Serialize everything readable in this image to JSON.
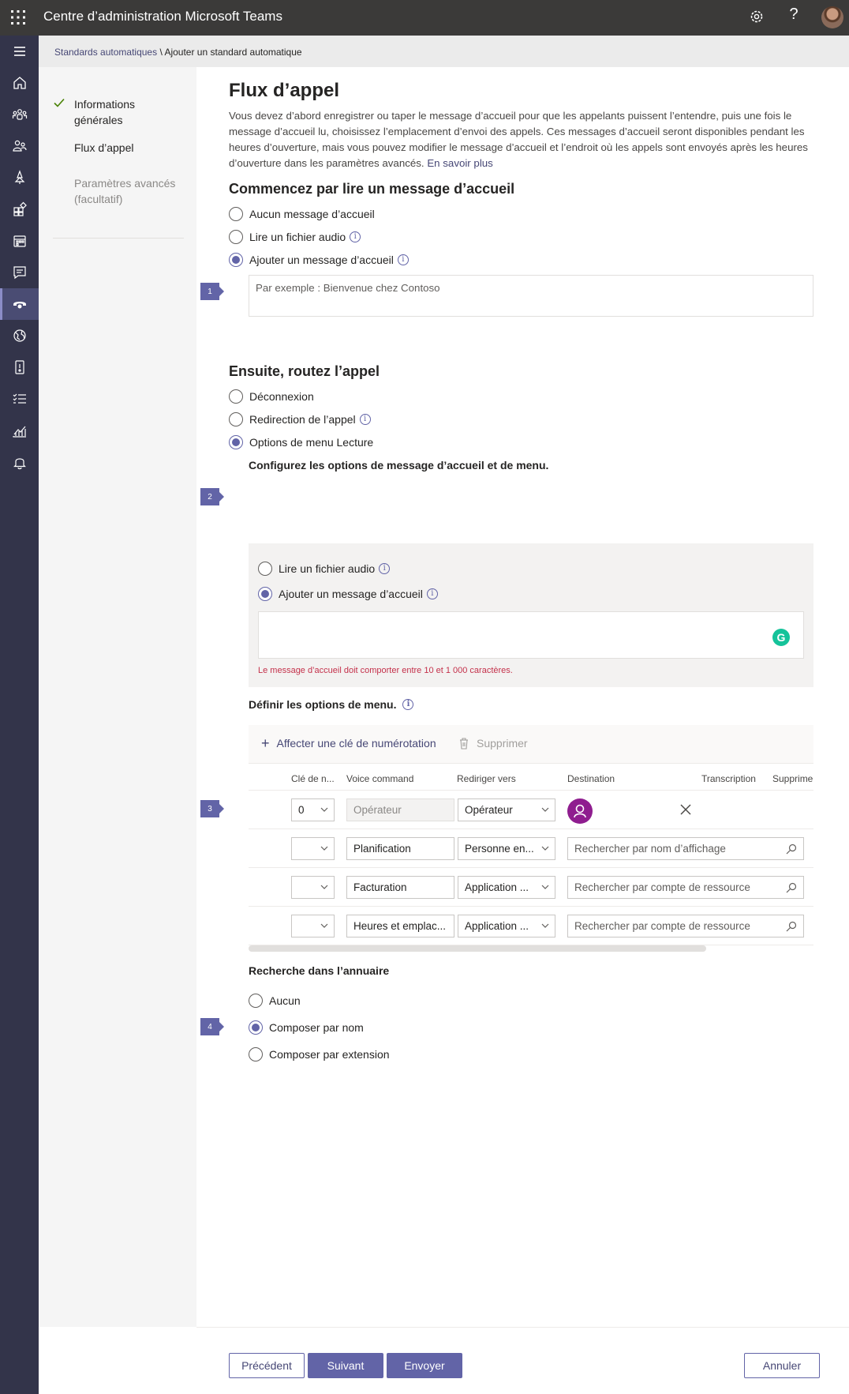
{
  "app": {
    "title": "Centre d’administration Microsoft Teams"
  },
  "breadcrumb": {
    "parent": "Standards automatiques",
    "separator": "\\",
    "current": "Ajouter un standard automatique"
  },
  "steps": [
    {
      "label": "Informations générales",
      "state": "done"
    },
    {
      "label": "Flux d’appel",
      "state": "current"
    },
    {
      "label": "Paramètres avancés (facultatif)",
      "state": "pending"
    }
  ],
  "page": {
    "title": "Flux d’appel",
    "intro": "Vous devez d’abord enregistrer ou taper le message d’accueil pour que les appelants puissent l’entendre, puis une fois le message d’accueil lu, choisissez l’emplacement d’envoi des appels. Ces messages d’accueil seront disponibles pendant les heures d’ouverture, mais vous pouvez modifier le message d’accueil et l’endroit où les appels sont envoyés après les heures d’ouverture dans les paramètres avancés.",
    "learn_more": "En savoir plus"
  },
  "greeting": {
    "title": "Commencez par lire un message d’accueil",
    "options": [
      "Aucun message d’accueil",
      "Lire un fichier audio",
      "Ajouter un message d’accueil"
    ],
    "selected": 2,
    "placeholder": "Par exemple : Bienvenue chez Contoso"
  },
  "routing": {
    "title": "Ensuite, routez l’appel",
    "options": [
      "Déconnexion",
      "Redirection de l’appel",
      "Options de menu Lecture"
    ],
    "selected": 2
  },
  "menu_config": {
    "title": "Configurez les options de message d’accueil et de menu.",
    "options": [
      "Lire un fichier audio",
      "Ajouter un message d’accueil"
    ],
    "selected": 1,
    "error": "Le message d’accueil doit comporter entre 10 et 1 000 caractères.",
    "grammarly_glyph": "G"
  },
  "menu_options": {
    "title": "Définir les options de menu.",
    "add_label": "Affecter une clé de numérotation",
    "delete_label": "Supprimer",
    "columns": [
      "Clé de n...",
      "Voice command",
      "Rediriger vers",
      "Destination",
      "Transcription",
      "Supprime"
    ],
    "rows": [
      {
        "key": "0",
        "voice": "Opérateur",
        "redirect": "Opérateur",
        "destination": ""
      },
      {
        "key": "",
        "voice": "Planification",
        "redirect": "Personne en...",
        "destination": "Rechercher par nom d’affichage"
      },
      {
        "key": "",
        "voice": "Facturation",
        "redirect": "Application ...",
        "destination": "Rechercher par compte de ressource"
      },
      {
        "key": "",
        "voice": "Heures et emplac...",
        "redirect": "Application ...",
        "destination": "Rechercher par compte de ressource"
      }
    ]
  },
  "directory": {
    "title": "Recherche dans l’annuaire",
    "options": [
      "Aucun",
      "Composer par nom",
      "Composer par extension"
    ],
    "selected": 1
  },
  "markers": [
    "1",
    "2",
    "3",
    "4"
  ],
  "footer": {
    "previous": "Précédent",
    "next": "Suivant",
    "submit": "Envoyer",
    "cancel": "Annuler"
  },
  "icons": {
    "rail": [
      "menu-icon",
      "home-icon",
      "teams-icon",
      "users-icon",
      "deployment-icon",
      "apps-icon",
      "meetings-icon",
      "messaging-icon",
      "voice-icon",
      "locations-icon",
      "policy-packages-icon",
      "planning-icon",
      "analytics-icon",
      "notifications-icon"
    ]
  },
  "colors": {
    "accent": "#6264a7",
    "topbar": "#3b3a39",
    "rail": "#33344a",
    "error": "#c4314b",
    "destination_avatar": "#8f1d8f"
  }
}
